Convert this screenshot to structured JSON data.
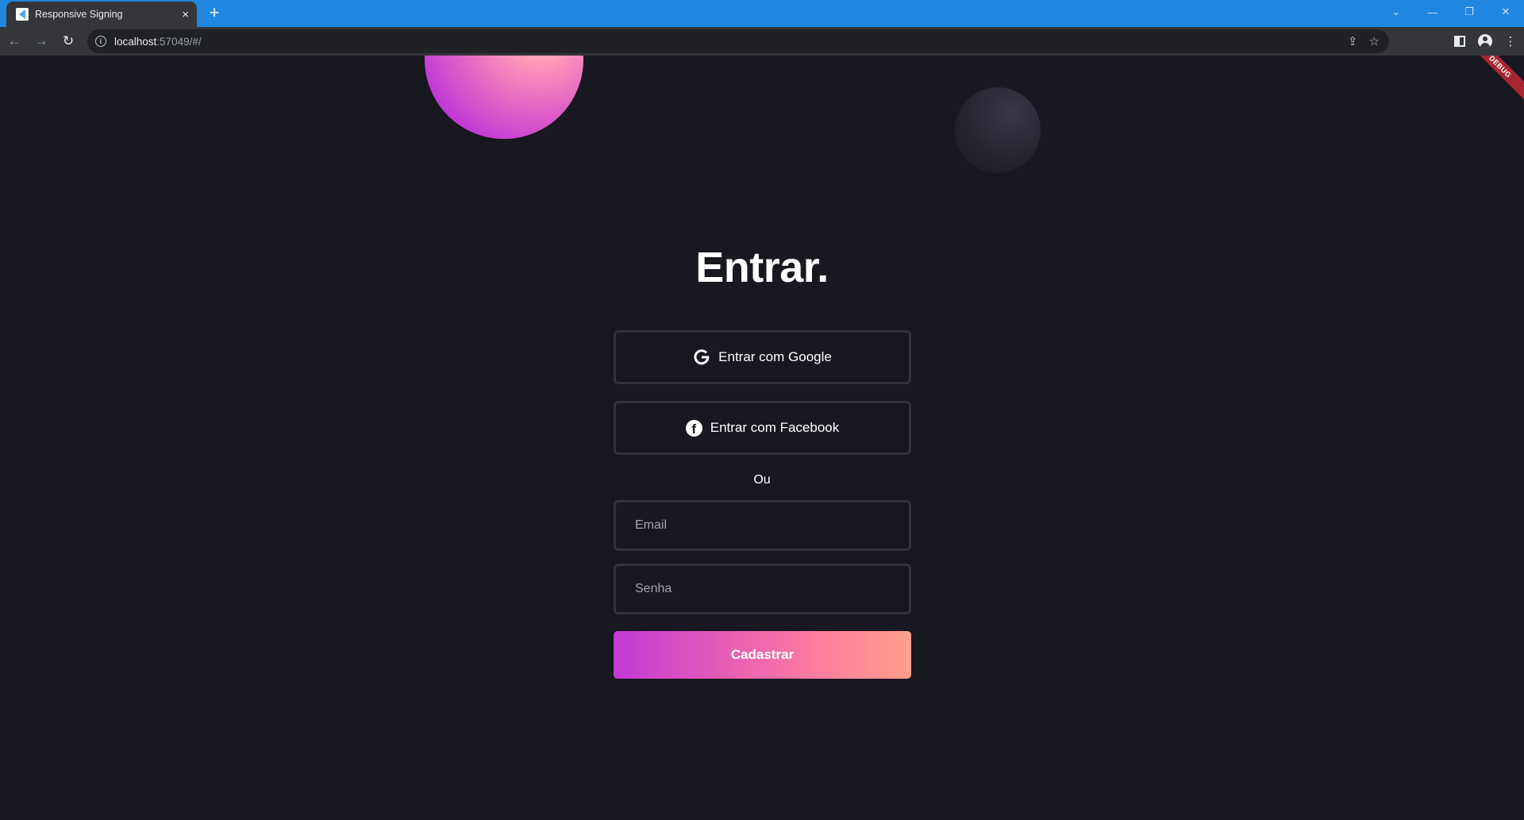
{
  "browser": {
    "tab_title": "Responsive Signing",
    "tab_close": "×",
    "new_tab": "+",
    "url_host": "localhost",
    "url_rest": ":57049/#/"
  },
  "page": {
    "debug_label": "DEBUG",
    "title": "Entrar.",
    "google_button": "Entrar com Google",
    "facebook_button": "Entrar com Facebook",
    "divider": "Ou",
    "email_placeholder": "Email",
    "password_placeholder": "Senha",
    "submit_button": "Cadastrar"
  },
  "colors": {
    "background": "#181820",
    "accent_start": "#c23ad6",
    "accent_end": "#ff9f8a",
    "titlebar": "#1f87df"
  }
}
